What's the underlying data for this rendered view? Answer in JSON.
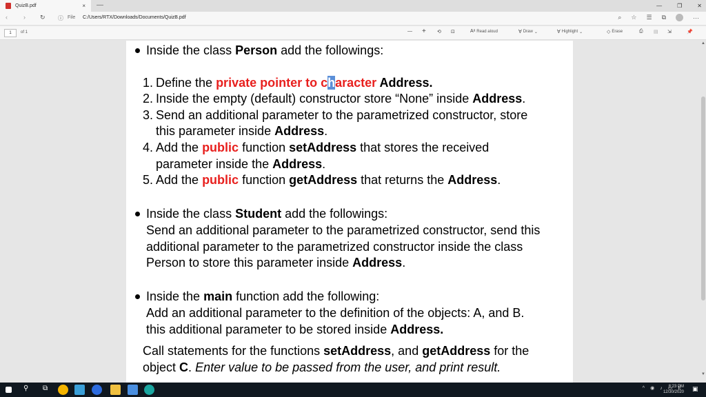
{
  "browser": {
    "tab_title": "QuizB.pdf",
    "tab_close": "×",
    "new_tab": "—",
    "window_min": "—",
    "window_max": "❐",
    "window_close": "✕",
    "info_icon": "ⓘ",
    "file_label": "File",
    "url": "C:/Users/RTX/Downloads/Documents/QuizB.pdf",
    "more": "···"
  },
  "pdf_toolbar": {
    "page_number": "1",
    "page_of": "of 1",
    "zoom_out": "—",
    "zoom_in": "+",
    "read_aloud": "Read aloud",
    "draw": "Draw",
    "highlight": "Highlight",
    "erase": "Erase"
  },
  "document": {
    "b1_pre": "Inside the class ",
    "b1_bold": "Person",
    "b1_post": " add the followings:",
    "l1_num": "1.",
    "l1_a": "Define the ",
    "l1_red1": "private pointer to c",
    "l1_hl": "h",
    "l1_red2": "aracter",
    "l1_b": " Address.",
    "l2_num": "2.",
    "l2_a": "Inside the empty (default) constructor store “None” inside ",
    "l2_b": "Address",
    "l2_c": ".",
    "l3_num": "3.",
    "l3_a": "Send an additional parameter to the parametrized constructor, store",
    "l3b_a": "this parameter inside ",
    "l3b_b": "Address",
    "l3b_c": ".",
    "l4_num": "4.",
    "l4_a": "Add the ",
    "l4_red": "public",
    "l4_b": " function ",
    "l4_bold": "setAddress",
    "l4_c": " that stores the received",
    "l4b_a": "parameter inside the ",
    "l4b_b": "Address",
    "l4b_c": ".",
    "l5_num": "5.",
    "l5_a": "Add the ",
    "l5_red": "public",
    "l5_b": " function ",
    "l5_bold": "getAddress",
    "l5_c": " that returns the ",
    "l5_bold2": "Address",
    "l5_d": ".",
    "b2_pre": "Inside the class ",
    "b2_bold": "Student",
    "b2_post": " add the followings:",
    "b2_l1": "Send an additional parameter to the parametrized constructor, send this",
    "b2_l2": "additional parameter to the parametrized constructor inside the class",
    "b2_l3_a": "Person to store this parameter inside ",
    "b2_l3_b": "Address",
    "b2_l3_c": ".",
    "b3_pre": "Inside the ",
    "b3_bold": "main",
    "b3_post": " function add the following:",
    "b3_l1": "Add an additional parameter to the definition of the objects: A, and B.",
    "b3_l2_a": "this additional parameter to be stored inside ",
    "b3_l2_b": "Address.",
    "c_l1_a": "Call statements for the functions ",
    "c_l1_b": "setAddress",
    "c_l1_c": ", and ",
    "c_l1_d": "getAddress",
    "c_l1_e": " for the",
    "c_l2_a": "object ",
    "c_l2_b": "C",
    "c_l2_c": ". ",
    "c_l2_d": "Enter value to be passed from the user, and print result."
  },
  "taskbar": {
    "time": "8:23 PM",
    "date": "12/30/2020",
    "lang": "E"
  }
}
